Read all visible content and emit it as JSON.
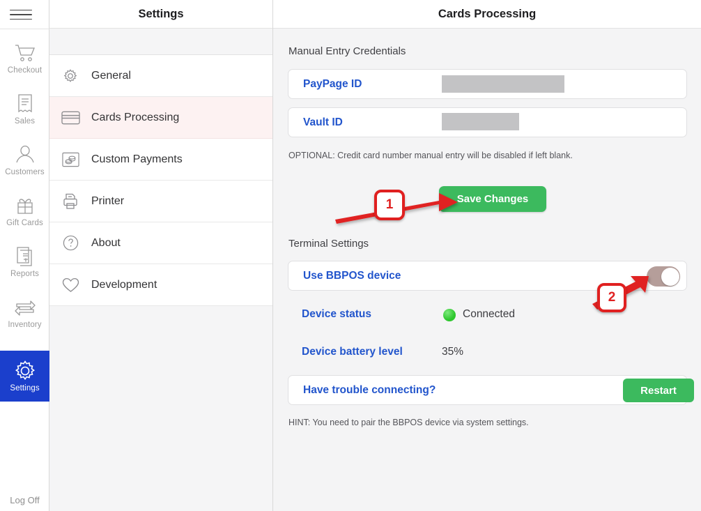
{
  "window": {
    "hamburger_icon": "hamburger-menu-icon"
  },
  "nav_rail": {
    "items": [
      {
        "label": "Checkout",
        "icon": "shopping-cart-icon",
        "active": false
      },
      {
        "label": "Sales",
        "icon": "receipt-icon",
        "active": false
      },
      {
        "label": "Customers",
        "icon": "person-icon",
        "active": false
      },
      {
        "label": "Gift Cards",
        "icon": "gift-icon",
        "active": false
      },
      {
        "label": "Reports",
        "icon": "report-dollar-icon",
        "active": false
      },
      {
        "label": "Inventory",
        "icon": "exchange-arrows-icon",
        "active": false
      },
      {
        "label": "Settings",
        "icon": "gear-icon",
        "active": true
      }
    ],
    "log_off": "Log Off",
    "active_bg": "#1b3fcc"
  },
  "settings_panel": {
    "title": "Settings",
    "items": [
      {
        "label": "General",
        "icon": "gear-icon",
        "selected": false
      },
      {
        "label": "Cards Processing",
        "icon": "credit-card-icon",
        "selected": true
      },
      {
        "label": "Custom Payments",
        "icon": "coins-icon",
        "selected": false
      },
      {
        "label": "Printer",
        "icon": "printer-icon",
        "selected": false
      },
      {
        "label": "About",
        "icon": "question-circle-icon",
        "selected": false
      },
      {
        "label": "Development",
        "icon": "heart-icon",
        "selected": false
      }
    ],
    "selected_bg": "#fdf2f2"
  },
  "main": {
    "title": "Cards Processing",
    "manual_entry": {
      "heading": "Manual Entry Credentials",
      "fields": [
        {
          "label": "PayPage ID",
          "value": "",
          "redacted": true
        },
        {
          "label": "Vault ID",
          "value": "",
          "redacted": true
        }
      ],
      "note": "OPTIONAL: Credit card number manual entry will be disabled if left blank.",
      "save_label": "Save Changes",
      "save_color": "#3cba5e"
    },
    "terminal": {
      "heading": "Terminal Settings",
      "toggle_label": "Use BBPOS device",
      "toggle_on": true,
      "toggle_color": "#b59e9a",
      "status_label": "Device status",
      "status_value": "Connected",
      "status_color": "#2ec72e",
      "battery_label": "Device battery level",
      "battery_value": "35%",
      "trouble_label": "Have trouble connecting?",
      "restart_label": "Restart",
      "restart_color": "#3cba5e",
      "hint": "HINT: You need to pair the BBPOS device via system settings."
    }
  },
  "annotations": {
    "color": "#e02020",
    "markers": [
      {
        "number": "1",
        "points_to": "Save Changes"
      },
      {
        "number": "2",
        "points_to": "Use BBPOS device toggle"
      }
    ]
  }
}
